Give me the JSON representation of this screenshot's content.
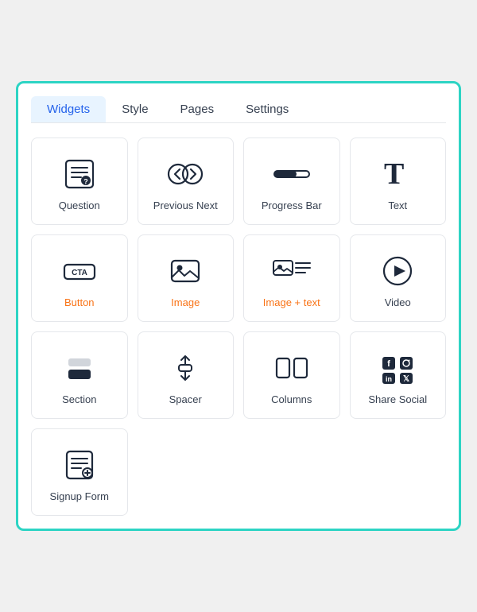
{
  "tabs": [
    {
      "id": "widgets",
      "label": "Widgets",
      "active": true
    },
    {
      "id": "style",
      "label": "Style",
      "active": false
    },
    {
      "id": "pages",
      "label": "Pages",
      "active": false
    },
    {
      "id": "settings",
      "label": "Settings",
      "active": false
    }
  ],
  "widgets": [
    {
      "id": "question",
      "label": "Question",
      "label_color": "normal"
    },
    {
      "id": "previous-next",
      "label": "Previous Next",
      "label_color": "normal"
    },
    {
      "id": "progress-bar",
      "label": "Progress Bar",
      "label_color": "normal"
    },
    {
      "id": "text",
      "label": "Text",
      "label_color": "normal"
    },
    {
      "id": "button",
      "label": "Button",
      "label_color": "orange"
    },
    {
      "id": "image",
      "label": "Image",
      "label_color": "orange"
    },
    {
      "id": "image-text",
      "label": "Image + text",
      "label_color": "orange"
    },
    {
      "id": "video",
      "label": "Video",
      "label_color": "normal"
    },
    {
      "id": "section",
      "label": "Section",
      "label_color": "normal"
    },
    {
      "id": "spacer",
      "label": "Spacer",
      "label_color": "normal"
    },
    {
      "id": "columns",
      "label": "Columns",
      "label_color": "normal"
    },
    {
      "id": "share-social",
      "label": "Share Social",
      "label_color": "normal"
    },
    {
      "id": "signup-form",
      "label": "Signup Form",
      "label_color": "normal"
    }
  ]
}
